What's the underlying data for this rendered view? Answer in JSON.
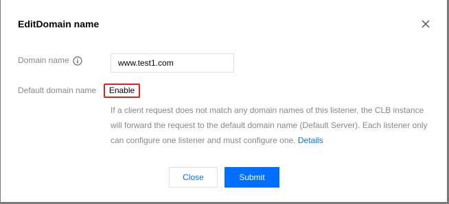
{
  "dialog": {
    "title": "EditDomain name",
    "close_icon": "close-icon"
  },
  "form": {
    "domain_name_label": "Domain name",
    "info_icon": "info-circle-icon",
    "domain_name_value": "www.test1.com",
    "default_domain_label": "Default domain name",
    "default_domain_value": "Enable",
    "description": "If a client request does not match any domain names of this listener, the CLB instance will forward the request to the default domain name (Default Server). Each listener only can configure one listener and must configure one.",
    "details_link": "Details"
  },
  "buttons": {
    "close_label": "Close",
    "submit_label": "Submit"
  },
  "colors": {
    "accent": "#006eff",
    "highlight_border": "#e02020",
    "label_gray": "#888888",
    "backdrop": "#7a7a7a"
  }
}
